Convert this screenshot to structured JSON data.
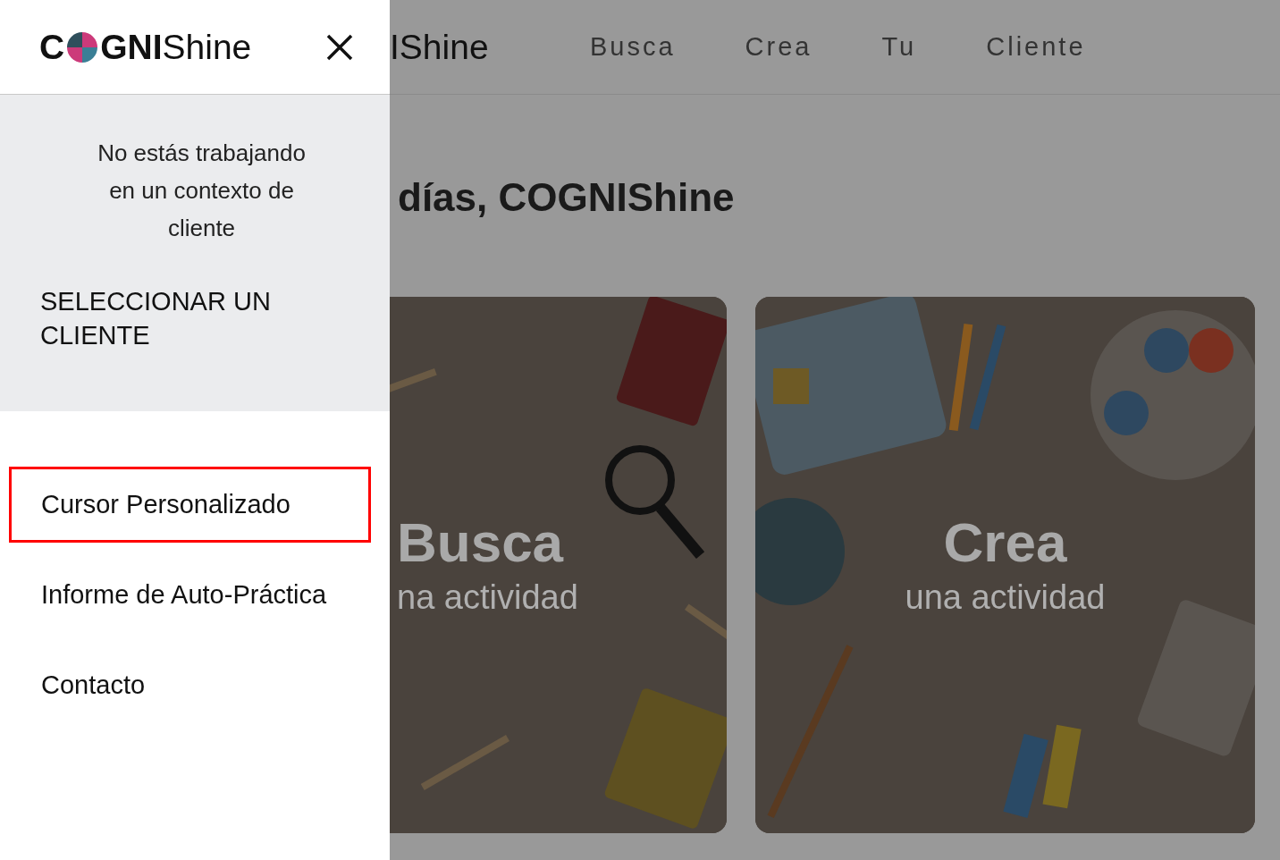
{
  "drawer": {
    "logo": {
      "lead": "C",
      "bold": "GNI",
      "light": "Shine"
    },
    "context_notice": "No estás trabajando en un contexto de cliente",
    "select_client": "SELECCIONAR UN CLIENTE",
    "menu": [
      {
        "label": "Cursor Personalizado",
        "selected": true
      },
      {
        "label": "Informe de Auto-Práctica",
        "selected": false
      },
      {
        "label": "Contacto",
        "selected": false
      }
    ]
  },
  "page": {
    "logo_visible": "IShine",
    "nav": [
      "Busca",
      "Crea",
      "Tu",
      "Cliente"
    ],
    "greeting": "días, COGNIShine",
    "cards": [
      {
        "title": "Busca",
        "subtitle": "na actividad",
        "kind": "cut"
      },
      {
        "title": "Crea",
        "subtitle": "una actividad",
        "kind": "full"
      }
    ]
  }
}
